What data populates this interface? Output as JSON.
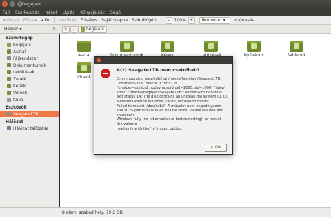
{
  "window": {
    "title": "hegejani"
  },
  "menubar": [
    "Fájl",
    "Szerkesztés",
    "Nézet",
    "Ugrás",
    "Könyvjelzők",
    "Súgó"
  ],
  "toolbar": {
    "back": "Vissza",
    "forward": "Előre",
    "up": "Fel",
    "stop": "Leállítás",
    "reload": "Frissítés",
    "home": "Saját mappa",
    "computer": "Számítógép",
    "zoom": "100%",
    "view": "Ikonnézet",
    "search": "Keresés"
  },
  "places": {
    "header": "Helyek",
    "close": "×"
  },
  "breadcrumb": {
    "current": "hegejani"
  },
  "sidebar": {
    "sections": [
      {
        "title": "Számítógép",
        "items": [
          {
            "label": "hegejani",
            "icon": "home-icon"
          },
          {
            "label": "Asztal",
            "icon": "folder-icon"
          },
          {
            "label": "Fájlrendszer",
            "icon": "disk-icon"
          },
          {
            "label": "Dokumentumok",
            "icon": "folder-icon"
          },
          {
            "label": "Letöltések",
            "icon": "folder-icon"
          },
          {
            "label": "Zenék",
            "icon": "folder-icon"
          },
          {
            "label": "Képek",
            "icon": "folder-icon"
          },
          {
            "label": "Videók",
            "icon": "folder-icon"
          },
          {
            "label": "Kuka",
            "icon": "trash-icon"
          }
        ]
      },
      {
        "title": "Eszközök",
        "items": [
          {
            "label": "Seagate1TB",
            "icon": "disk-icon",
            "selected": true
          }
        ]
      },
      {
        "title": "Hálózat",
        "items": [
          {
            "label": "Hálózat tallózása",
            "icon": "network-icon"
          }
        ]
      }
    ]
  },
  "files": [
    {
      "label": "Asztal"
    },
    {
      "label": "Dokumentumok"
    },
    {
      "label": "Képek"
    },
    {
      "label": "Letöltések"
    },
    {
      "label": "Nyilvános"
    },
    {
      "label": "Sablonok"
    },
    {
      "label": "Videók"
    }
  ],
  "status": {
    "text": "8 elem, szabad hely: 79,2 GB"
  },
  "dialog": {
    "title": "A(z) Seagate1TB nem csatolható",
    "message": "Error mounting /dev/sdb2 at /media/hegejani/Seagate1TB:\nCommand-line `mount -t \"ntfs\" -o\n\"uhelper=udisks2,nodev,nosuid,uid=1000,gid=1000\" \"/dev/\nsdb2\" \"/media/hegejani/Seagate1TB\"' exited with non-zero\nexit status 14: The disk contains an unclean file system (0, 0).\nMetadata kept in Windows cache, refused to mount.\nFailed to mount '/dev/sdb2': A művelet nem engedélyezett\nThe NTFS partition is in an unsafe state. Please resume and\nshutdown\nWindows fully (no hibernation or fast restarting), or mount\nthe volume\nread-only with the 'ro' mount option.",
    "ok": "OK"
  }
}
